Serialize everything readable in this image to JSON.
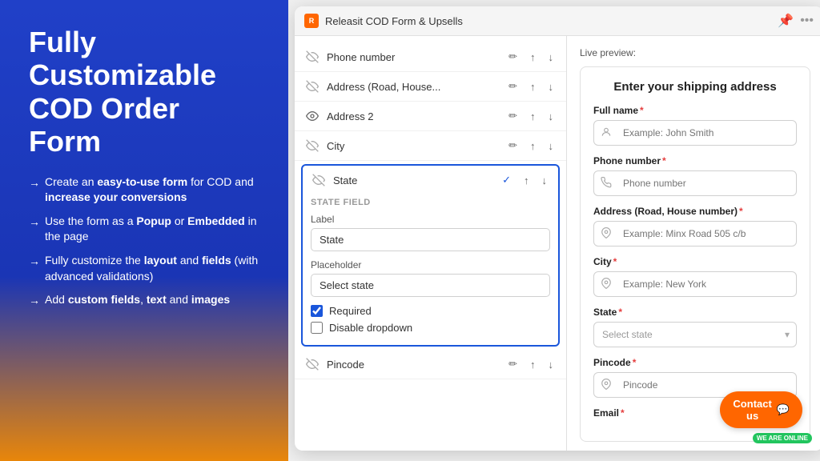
{
  "left": {
    "title": "Fully\nCustomizable\nCOD Order Form",
    "bullets": [
      {
        "text": "Create an ",
        "bold": "easy-to-use form",
        "suffix": " for COD and increase your conversions"
      },
      {
        "text": "Use the form as a ",
        "bold": "Popup",
        "suffix": " or ",
        "bold2": "Embedded",
        "suffix2": " in the page"
      },
      {
        "text": "Fully customize the ",
        "bold": "layout",
        "suffix": " and ",
        "bold2": "fields",
        "suffix2": " (with advanced validations)"
      },
      {
        "text": "Add ",
        "bold": "custom fields",
        "suffix": ", ",
        "bold2": "text",
        "suffix2": " and ",
        "bold3": "images"
      }
    ]
  },
  "app": {
    "title": "Releasit COD Form & Upsells"
  },
  "form_builder": {
    "fields": [
      {
        "id": "phone",
        "label": "Phone number",
        "visible": false
      },
      {
        "id": "address",
        "label": "Address (Road, House...",
        "visible": false
      },
      {
        "id": "address2",
        "label": "Address 2",
        "visible": true
      },
      {
        "id": "city",
        "label": "City",
        "visible": false
      },
      {
        "id": "state",
        "label": "State",
        "visible": false,
        "active": true
      },
      {
        "id": "pincode",
        "label": "Pincode",
        "visible": false
      }
    ],
    "state_field": {
      "section_title": "STATE FIELD",
      "label_label": "Label",
      "label_value": "State",
      "placeholder_label": "Placeholder",
      "placeholder_value": "Select state",
      "required_label": "Required",
      "required_checked": true,
      "disable_dropdown_label": "Disable dropdown",
      "disable_dropdown_checked": false
    }
  },
  "preview": {
    "label": "Live preview:",
    "title": "Enter your shipping address",
    "fields": [
      {
        "id": "full_name",
        "label": "Full name",
        "required": true,
        "placeholder": "Example: John Smith",
        "type": "text",
        "icon": "👤"
      },
      {
        "id": "phone",
        "label": "Phone number",
        "required": true,
        "placeholder": "Phone number",
        "type": "text",
        "icon": "📞"
      },
      {
        "id": "address",
        "label": "Address (Road, House number)",
        "required": true,
        "placeholder": "Example: Minx Road 505 c/b",
        "type": "text",
        "icon": "📍"
      },
      {
        "id": "city",
        "label": "City",
        "required": true,
        "placeholder": "Example: New York",
        "type": "text",
        "icon": "📍"
      },
      {
        "id": "state",
        "label": "State",
        "required": true,
        "placeholder": "Select state",
        "type": "select"
      },
      {
        "id": "pincode",
        "label": "Pincode",
        "required": true,
        "placeholder": "Pincode",
        "type": "text",
        "icon": "📍"
      },
      {
        "id": "email",
        "label": "Email",
        "required": true,
        "placeholder": "",
        "type": "text",
        "icon": ""
      }
    ]
  },
  "contact": {
    "online_text": "WE ARE ONLINE",
    "button_text": "Contact us"
  },
  "icons": {
    "eye_closed": "🚫",
    "eye_open": "👁",
    "pencil": "✏",
    "arrow_up": "↑",
    "arrow_down": "↓",
    "check": "✓",
    "bell": "🔔",
    "dots": "•••"
  }
}
